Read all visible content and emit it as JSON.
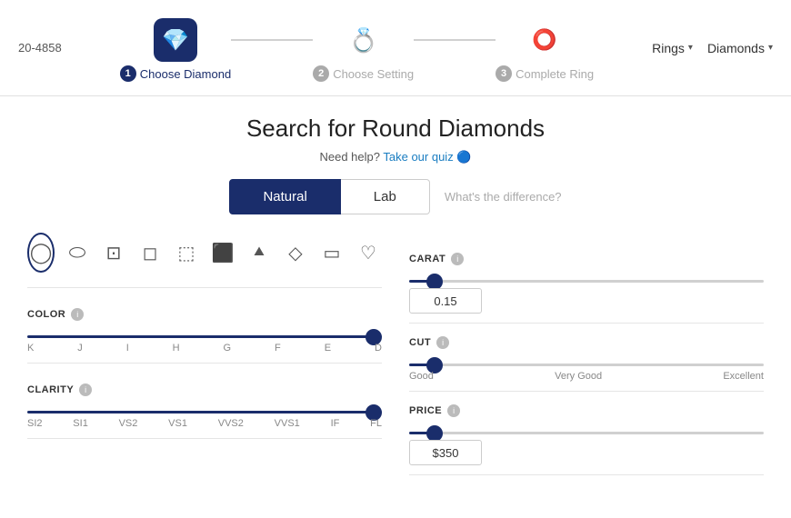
{
  "header": {
    "phone": "20-4858",
    "nav": [
      {
        "label": "Rings",
        "id": "rings"
      },
      {
        "label": "Diamonds",
        "id": "diamonds"
      }
    ]
  },
  "steps": [
    {
      "number": "1",
      "label": "Choose Diamond",
      "state": "active",
      "icon": "💎"
    },
    {
      "number": "2",
      "label": "Choose Setting",
      "state": "inactive",
      "icon": "💍"
    },
    {
      "number": "3",
      "label": "Complete Ring",
      "state": "inactive",
      "icon": "⭕"
    }
  ],
  "search": {
    "title": "Search for Round Diamonds",
    "help_text": "Need help?",
    "quiz_link": "Take our quiz",
    "toggle": {
      "natural_label": "Natural",
      "lab_label": "Lab",
      "diff_label": "What's the difference?"
    }
  },
  "shapes": [
    {
      "id": "round",
      "symbol": "◯",
      "selected": true
    },
    {
      "id": "oval",
      "symbol": "⬭",
      "selected": false
    },
    {
      "id": "cushion",
      "symbol": "▢",
      "selected": false
    },
    {
      "id": "princess",
      "symbol": "◻",
      "selected": false
    },
    {
      "id": "asscher",
      "symbol": "⬜",
      "selected": false
    },
    {
      "id": "radiant",
      "symbol": "⬛",
      "selected": false
    },
    {
      "id": "pear",
      "symbol": "🔻",
      "selected": false
    },
    {
      "id": "marquise",
      "symbol": "◇",
      "selected": false
    },
    {
      "id": "emerald",
      "symbol": "⬜",
      "selected": false
    },
    {
      "id": "heart",
      "symbol": "♡",
      "selected": false
    }
  ],
  "filters": {
    "color": {
      "label": "COLOR",
      "ticks": [
        "K",
        "J",
        "I",
        "H",
        "G",
        "F",
        "E",
        "D"
      ],
      "value_min": 0,
      "value_max": 100
    },
    "clarity": {
      "label": "CLARITY",
      "ticks": [
        "SI2",
        "SI1",
        "VS2",
        "VS1",
        "VVS2",
        "VVS1",
        "IF",
        "FL"
      ],
      "value_min": 0,
      "value_max": 100
    },
    "carat": {
      "label": "CARAT",
      "value": "0.15"
    },
    "cut": {
      "label": "CUT",
      "ticks": [
        "Good",
        "Very Good",
        "Excellent"
      ]
    },
    "price": {
      "label": "PRICE",
      "value": "$350"
    }
  }
}
